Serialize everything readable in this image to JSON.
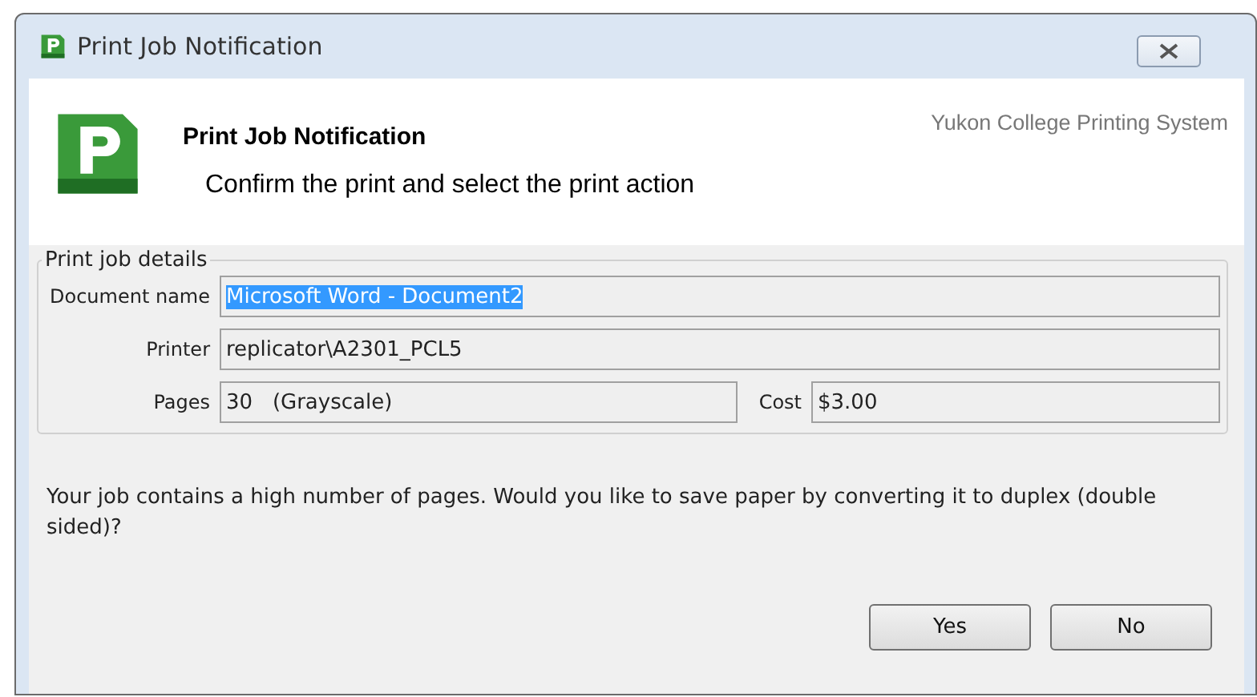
{
  "window": {
    "title": "Print Job Notification"
  },
  "header": {
    "title": "Print Job Notification",
    "subtitle": "Confirm the print and select the print action",
    "brand": "Yukon College Printing System"
  },
  "details": {
    "legend": "Print job details",
    "fields": [
      {
        "label": "Document name",
        "value": "Microsoft Word - Document2",
        "selected": true
      },
      {
        "label": "Printer",
        "value": "replicator\\A2301_PCL5",
        "selected": false
      }
    ],
    "pages": {
      "label": "Pages",
      "value": "30   (Grayscale)"
    },
    "cost": {
      "label": "Cost",
      "value": "$3.00"
    }
  },
  "message": "Your job contains a high number of pages. Would you like to save paper by converting it to duplex (double sided)?",
  "buttons": [
    "Yes",
    "No"
  ]
}
